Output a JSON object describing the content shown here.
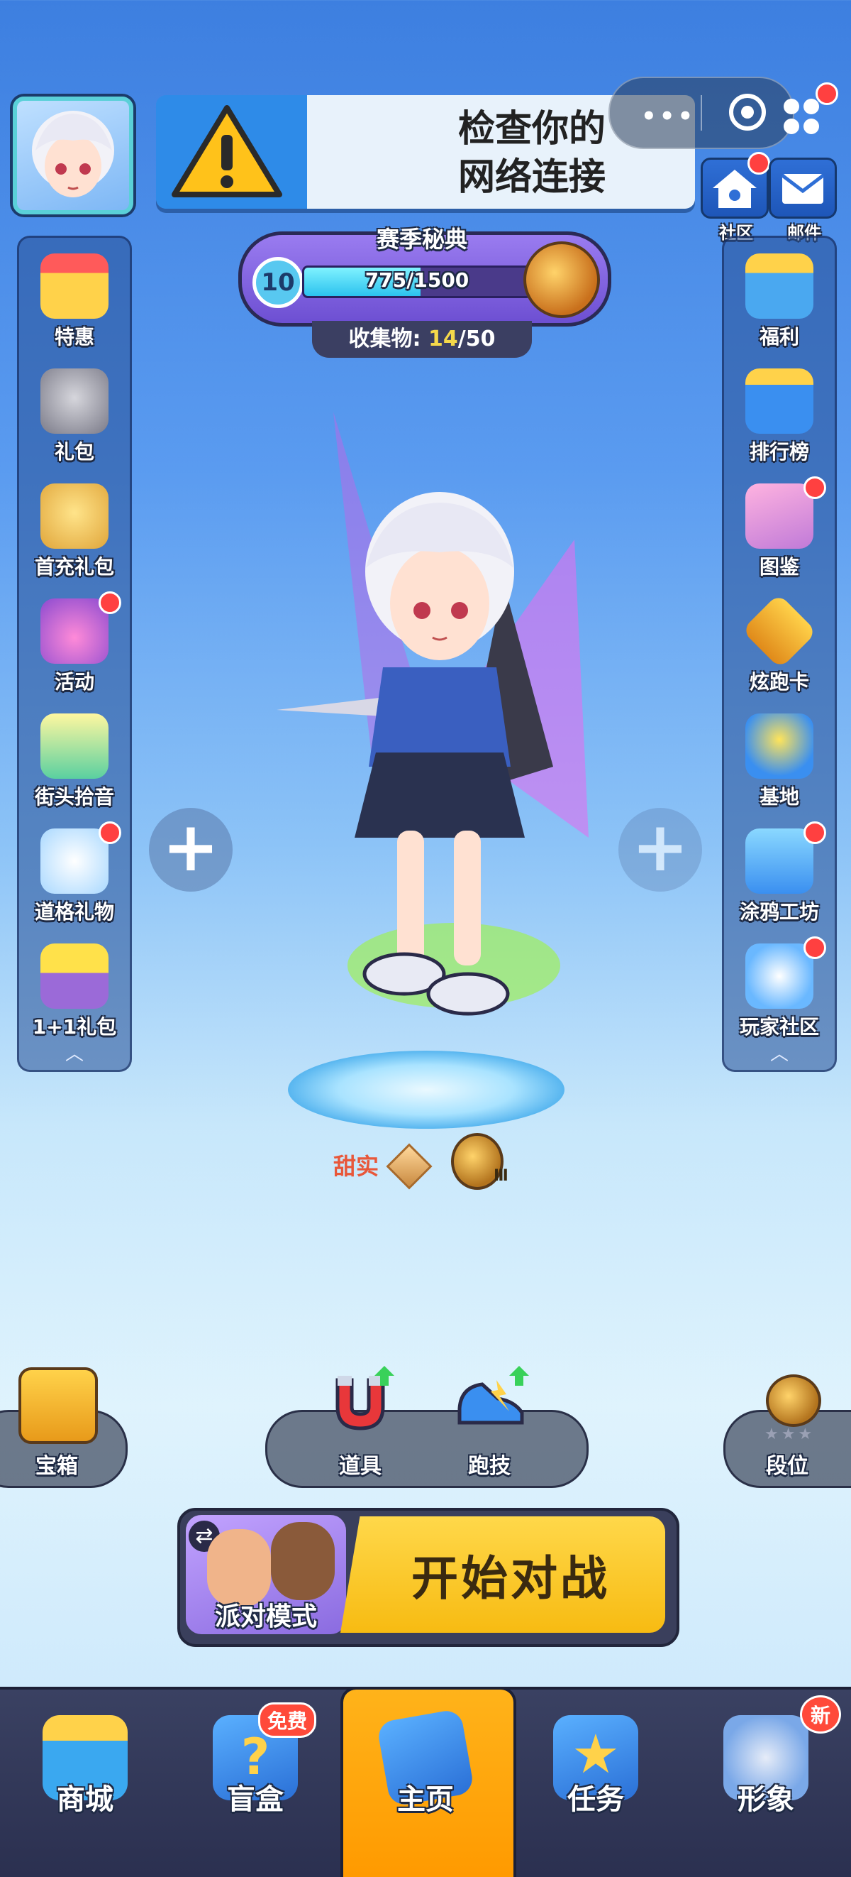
{
  "banner": {
    "line1": "检查你的",
    "line2": "网络连接"
  },
  "top_right": {
    "community": "社区",
    "mail": "邮件"
  },
  "season": {
    "title": "赛季秘典",
    "level": "10",
    "progress_text": "775/1500",
    "progress_fraction": 0.517,
    "collect_label": "收集物:",
    "collect_have": "14",
    "collect_total": "/50"
  },
  "left_rail": [
    "特惠",
    "礼包",
    "首充礼包",
    "活动",
    "街头拾音",
    "道格礼物",
    "1+1礼包"
  ],
  "right_rail": [
    "福利",
    "排行榜",
    "图鉴",
    "炫跑卡",
    "基地",
    "涂鸦工坊",
    "玩家社区"
  ],
  "player": {
    "name": "甜实",
    "rank_numeral": "Ⅲ"
  },
  "quick": {
    "chest": "宝箱",
    "items": "道具",
    "run_skill": "跑技",
    "rank": "段位"
  },
  "start": {
    "party_mode": "派对模式",
    "start_battle": "开始对战"
  },
  "nav": {
    "shop": "商城",
    "blind_box": "盲盒",
    "free_badge": "免费",
    "home": "主页",
    "tasks": "任务",
    "appearance": "形象",
    "new_badge": "新"
  },
  "colors": {
    "accent": "#ffb31a",
    "start_button": "#ffd84a",
    "notification": "#ff4040"
  }
}
